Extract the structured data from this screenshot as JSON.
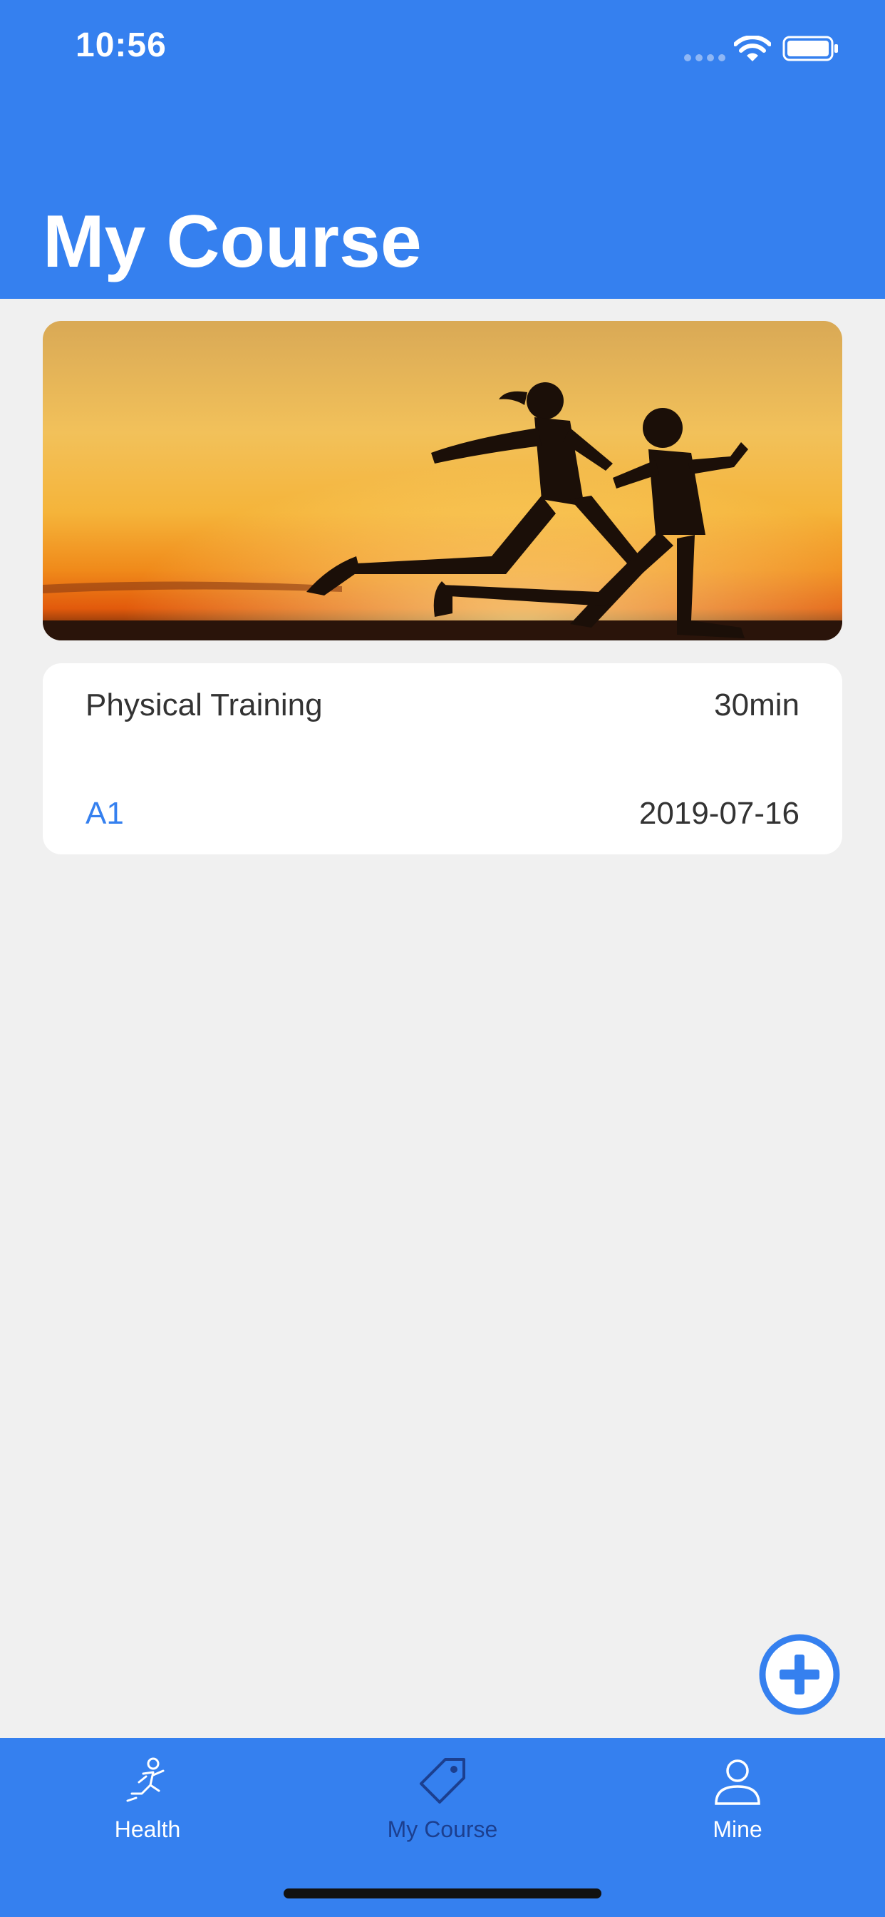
{
  "status_bar": {
    "time": "10:56"
  },
  "header": {
    "title": "My Course"
  },
  "course": {
    "name": "Physical Training",
    "duration": "30min",
    "code": "A1",
    "date": "2019-07-16"
  },
  "tabs": [
    {
      "label": "Health",
      "icon": "running-person-icon",
      "active": false
    },
    {
      "label": "My Course",
      "icon": "tag-icon",
      "active": true
    },
    {
      "label": "Mine",
      "icon": "person-icon",
      "active": false
    }
  ],
  "colors": {
    "primary": "#3580ef",
    "active_tab": "#1c3f8f",
    "background": "#f0f0f0",
    "card": "#ffffff"
  }
}
